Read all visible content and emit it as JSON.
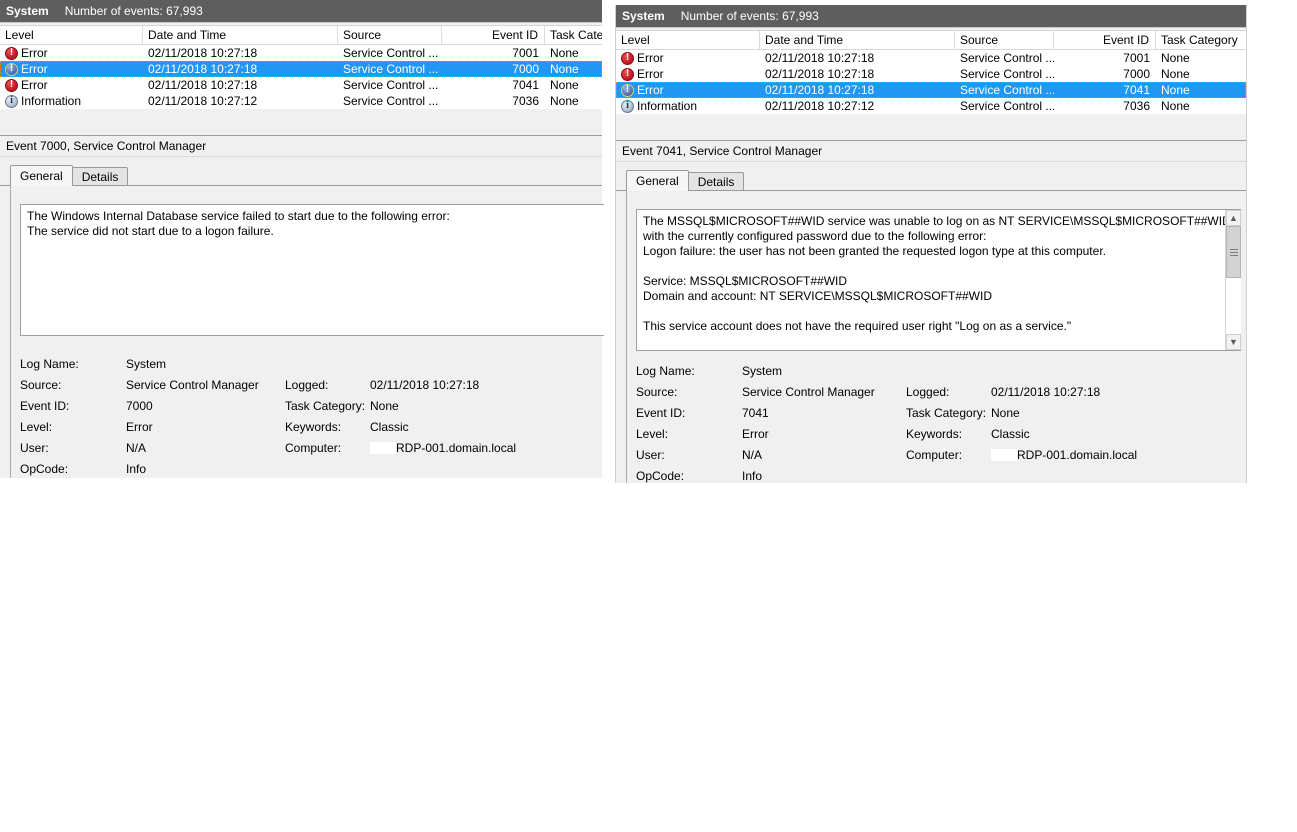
{
  "colors": {
    "titlebar_bg": "#5e5e5e",
    "titlebar_text": "#ffffff",
    "selection_bg": "#2196f3",
    "selection_text": "#ffffff",
    "panel_bg": "#f0f0f0",
    "error_icon": "#cc1f26",
    "information_icon": "#b9c6d8"
  },
  "left": {
    "titlebar": {
      "log_name": "System",
      "event_count": "Number of events: 67,993"
    },
    "columns": [
      "Level",
      "Date and Time",
      "Source",
      "Event ID",
      "Task Cate"
    ],
    "rows": [
      {
        "level": "Error",
        "icon": "error-icon",
        "datetime": "02/11/2018 10:27:18",
        "source": "Service Control ...",
        "event_id": "7001",
        "task_category": "None",
        "selected": false
      },
      {
        "level": "Error",
        "icon": "error-icon",
        "datetime": "02/11/2018 10:27:18",
        "source": "Service Control ...",
        "event_id": "7000",
        "task_category": "None",
        "selected": true
      },
      {
        "level": "Error",
        "icon": "error-icon",
        "datetime": "02/11/2018 10:27:18",
        "source": "Service Control ...",
        "event_id": "7041",
        "task_category": "None",
        "selected": false
      },
      {
        "level": "Information",
        "icon": "information-icon",
        "datetime": "02/11/2018 10:27:12",
        "source": "Service Control ...",
        "event_id": "7036",
        "task_category": "None",
        "selected": false
      }
    ],
    "detail": {
      "caption": "Event 7000, Service Control Manager",
      "tabs": [
        "General",
        "Details"
      ],
      "active_tab": "General",
      "description": "The Windows Internal Database service failed to start due to the following error:\nThe service did not start due to a logon failure."
    },
    "meta": {
      "log_name": {
        "label": "Log Name:",
        "value": "System"
      },
      "source": {
        "label": "Source:",
        "value": "Service Control Manager"
      },
      "event_id": {
        "label": "Event ID:",
        "value": "7000"
      },
      "level": {
        "label": "Level:",
        "value": "Error"
      },
      "user": {
        "label": "User:",
        "value": "N/A"
      },
      "opcode": {
        "label": "OpCode:",
        "value": "Info"
      },
      "logged": {
        "label": "Logged:",
        "value": "02/11/2018 10:27:18"
      },
      "task_category": {
        "label": "Task Category:",
        "value": "None"
      },
      "keywords": {
        "label": "Keywords:",
        "value": "Classic"
      },
      "computer": {
        "label": "Computer:",
        "value": "RDP-001.domain.local"
      }
    }
  },
  "right": {
    "titlebar": {
      "log_name": "System",
      "event_count": "Number of events: 67,993"
    },
    "columns": [
      "Level",
      "Date and Time",
      "Source",
      "Event ID",
      "Task Category"
    ],
    "rows": [
      {
        "level": "Error",
        "icon": "error-icon",
        "datetime": "02/11/2018 10:27:18",
        "source": "Service Control ...",
        "event_id": "7001",
        "task_category": "None",
        "selected": false
      },
      {
        "level": "Error",
        "icon": "error-icon",
        "datetime": "02/11/2018 10:27:18",
        "source": "Service Control ...",
        "event_id": "7000",
        "task_category": "None",
        "selected": false
      },
      {
        "level": "Error",
        "icon": "error-icon",
        "datetime": "02/11/2018 10:27:18",
        "source": "Service Control ...",
        "event_id": "7041",
        "task_category": "None",
        "selected": true
      },
      {
        "level": "Information",
        "icon": "information-icon",
        "datetime": "02/11/2018 10:27:12",
        "source": "Service Control ...",
        "event_id": "7036",
        "task_category": "None",
        "selected": false
      }
    ],
    "detail": {
      "caption": "Event 7041, Service Control Manager",
      "tabs": [
        "General",
        "Details"
      ],
      "active_tab": "General",
      "description": "The MSSQL$MICROSOFT##WID service was unable to log on as NT SERVICE\\MSSQL$MICROSOFT##WID with the currently configured password due to the following error:\nLogon failure: the user has not been granted the requested logon type at this computer.\n\nService: MSSQL$MICROSOFT##WID\nDomain and account: NT SERVICE\\MSSQL$MICROSOFT##WID\n\nThis service account does not have the required user right \"Log on as a service.\"",
      "scrollbar": {
        "up_arrow": "scroll-up-arrow-icon",
        "down_arrow": "scroll-down-arrow-icon"
      }
    },
    "meta": {
      "log_name": {
        "label": "Log Name:",
        "value": "System"
      },
      "source": {
        "label": "Source:",
        "value": "Service Control Manager"
      },
      "event_id": {
        "label": "Event ID:",
        "value": "7041"
      },
      "level": {
        "label": "Level:",
        "value": "Error"
      },
      "user": {
        "label": "User:",
        "value": "N/A"
      },
      "opcode": {
        "label": "OpCode:",
        "value": "Info"
      },
      "logged": {
        "label": "Logged:",
        "value": "02/11/2018 10:27:18"
      },
      "task_category": {
        "label": "Task Category:",
        "value": "None"
      },
      "keywords": {
        "label": "Keywords:",
        "value": "Classic"
      },
      "computer": {
        "label": "Computer:",
        "value": "RDP-001.domain.local"
      }
    }
  }
}
